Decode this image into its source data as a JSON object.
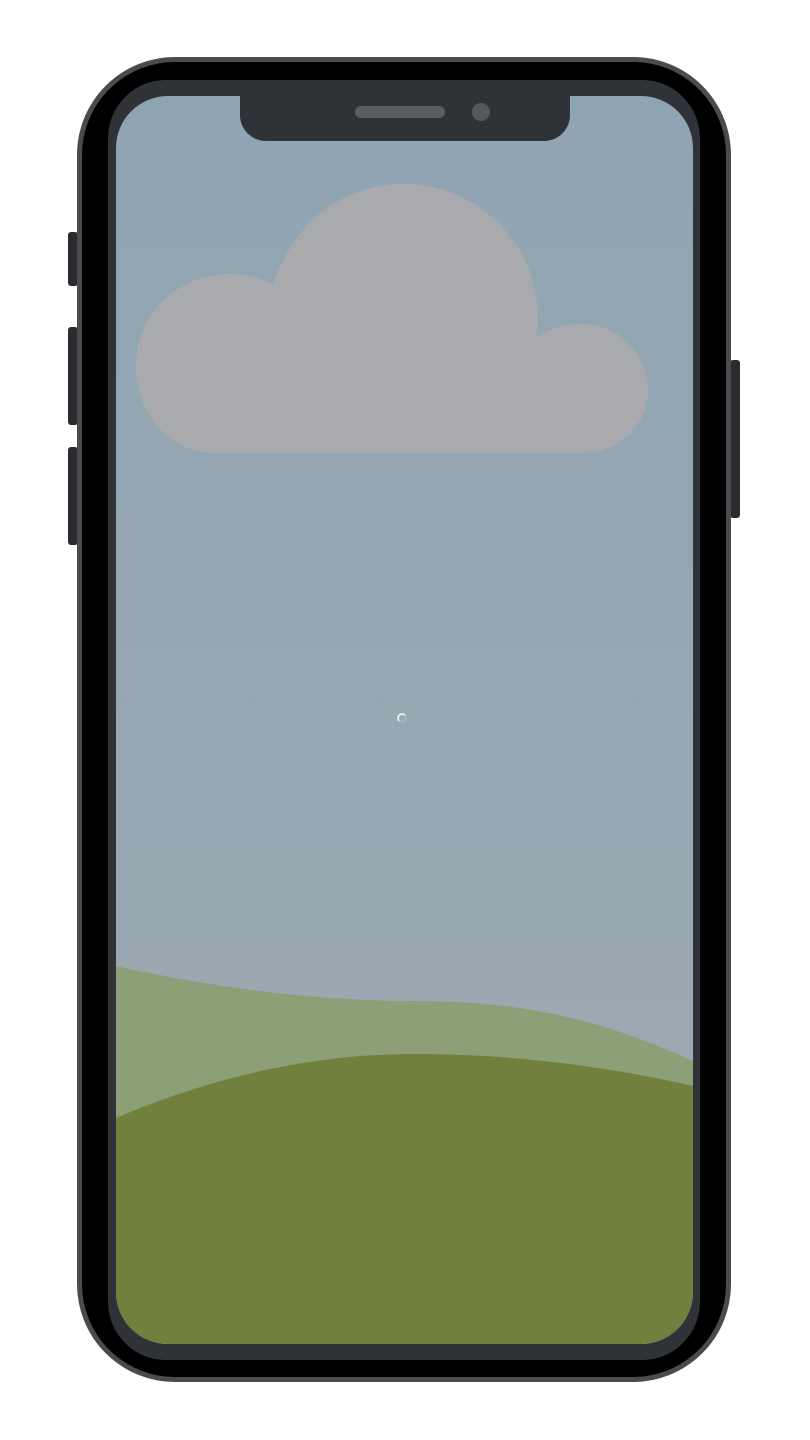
{
  "device": {
    "type": "smartphone",
    "frame_color": "#000000",
    "bezel_color": "#2f3237",
    "outline_color": "#4a4b4e"
  },
  "screen": {
    "state": "loading",
    "loading_indicator": "spinner-icon",
    "scene": {
      "sky_top_color": "#8fa4b3",
      "sky_bottom_color": "#a0aab2",
      "cloud_color": "#a8aaad",
      "back_hill_color": "#8d9f77",
      "front_hill_color": "#72803d"
    }
  }
}
